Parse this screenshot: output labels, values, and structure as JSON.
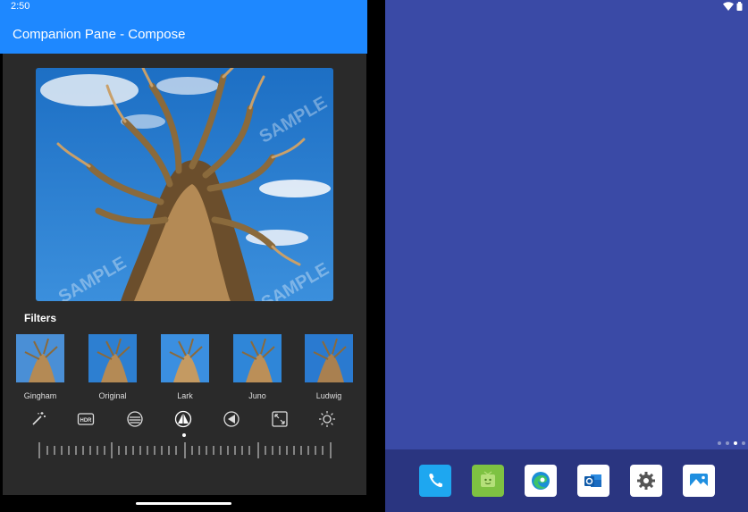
{
  "status_bar": {
    "time": "2:50"
  },
  "app_bar": {
    "title": "Companion Pane - Compose"
  },
  "main_photo": {
    "watermark": "SAMPLE"
  },
  "filters": {
    "heading": "Filters",
    "items": [
      {
        "label": "Gingham"
      },
      {
        "label": "Original"
      },
      {
        "label": "Lark"
      },
      {
        "label": "Juno"
      },
      {
        "label": "Ludwig"
      }
    ]
  },
  "tools": [
    {
      "icon": "magic-wand-icon"
    },
    {
      "icon": "hdr-icon"
    },
    {
      "icon": "contrast-stripes-icon"
    },
    {
      "icon": "sharpen-triangle-icon"
    },
    {
      "icon": "vignette-icon"
    },
    {
      "icon": "crop-expand-icon"
    },
    {
      "icon": "brightness-icon"
    }
  ],
  "selected_tool": "sharpen-triangle-icon",
  "dock": [
    {
      "icon": "phone-icon",
      "color": "#1ea7f0"
    },
    {
      "icon": "app-companion-icon",
      "color": "#7ec242"
    },
    {
      "icon": "edge-browser-icon",
      "color": "#ffffff"
    },
    {
      "icon": "outlook-icon",
      "color": "#ffffff"
    },
    {
      "icon": "settings-gear-icon",
      "color": "#ffffff"
    },
    {
      "icon": "photos-icon",
      "color": "#ffffff"
    }
  ],
  "colors": {
    "accent": "#1e88ff",
    "desktop": "#3a4aa6",
    "dock": "#2a3580",
    "panel": "#2a2a2a"
  }
}
